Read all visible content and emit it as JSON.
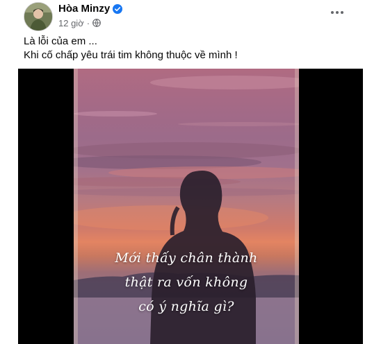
{
  "post": {
    "author": "Hòa Minzy",
    "time": "12 giờ",
    "separator": "·",
    "verified_icon": "verified-badge-icon",
    "privacy_icon": "globe-icon",
    "more_icon": "more-horizontal-icon",
    "text_lines": [
      "Là lỗi của em ...",
      "Khi cố chấp yêu trái tim không thuộc về mình !"
    ],
    "media": {
      "caption_lines": [
        "Mới thấy chân thành",
        "thật ra vốn không",
        "có ý nghĩa gì?"
      ]
    }
  },
  "colors": {
    "verified": "#1877f2",
    "secondary_text": "#65676b",
    "primary_text": "#050505"
  }
}
